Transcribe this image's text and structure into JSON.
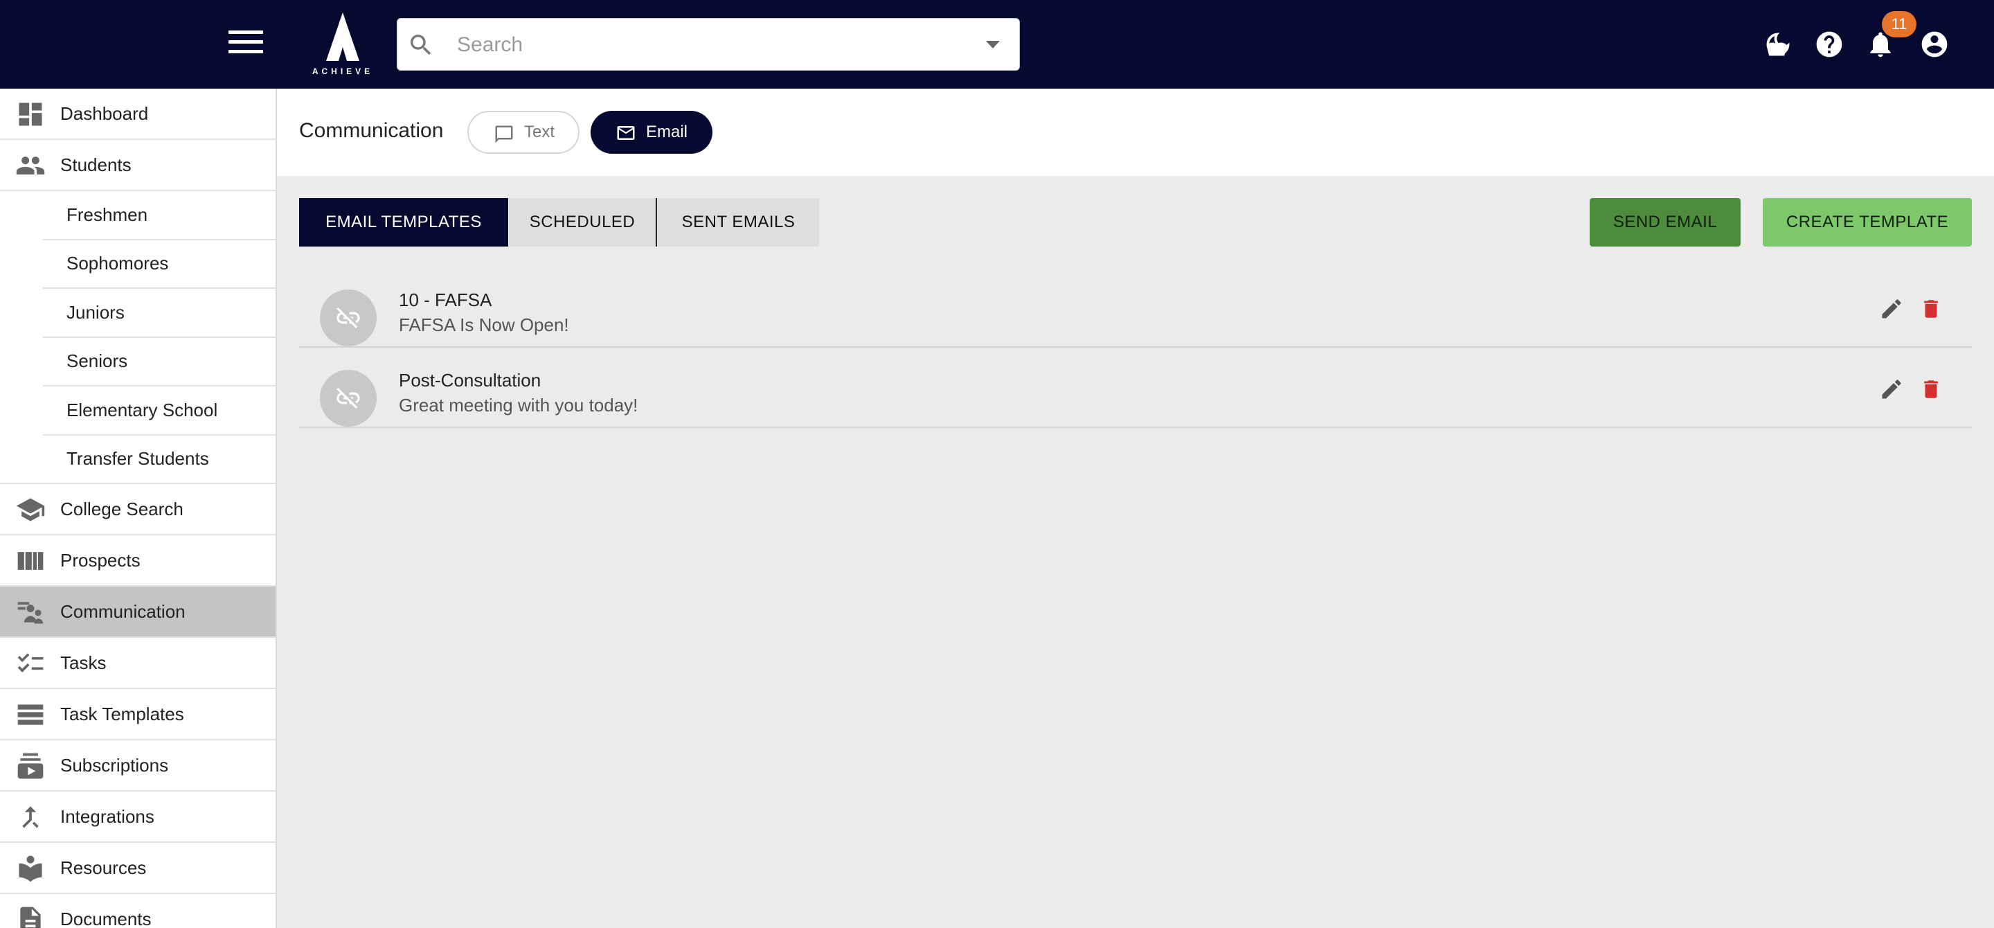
{
  "header": {
    "logo_text": "ACHIEVE",
    "search_placeholder": "Search",
    "notification_count": "11",
    "icons": [
      "menu-icon",
      "search-icon",
      "dropdown-caret-icon",
      "dark-mode-icon",
      "help-icon",
      "bell-icon",
      "account-icon"
    ]
  },
  "sidebar": {
    "items": [
      {
        "label": "Dashboard",
        "icon": "dashboard-icon"
      },
      {
        "label": "Students",
        "icon": "people-icon"
      },
      {
        "label": "College Search",
        "icon": "school-icon"
      },
      {
        "label": "Prospects",
        "icon": "columns-icon"
      },
      {
        "label": "Communication",
        "icon": "communication-icon",
        "active": true
      },
      {
        "label": "Tasks",
        "icon": "checklist-icon"
      },
      {
        "label": "Task Templates",
        "icon": "list-icon"
      },
      {
        "label": "Subscriptions",
        "icon": "subscriptions-icon"
      },
      {
        "label": "Integrations",
        "icon": "merge-icon"
      },
      {
        "label": "Resources",
        "icon": "book-icon"
      },
      {
        "label": "Documents",
        "icon": "document-icon"
      }
    ],
    "student_subitems": [
      "Freshmen",
      "Sophomores",
      "Juniors",
      "Seniors",
      "Elementary School",
      "Transfer Students"
    ]
  },
  "page": {
    "title": "Communication",
    "mode_toggle": {
      "text_label": "Text",
      "email_label": "Email",
      "selected": "Email"
    }
  },
  "tabs": {
    "email_templates": "EMAIL TEMPLATES",
    "scheduled": "SCHEDULED",
    "sent_emails": "SENT EMAILS",
    "active": "EMAIL TEMPLATES"
  },
  "actions": {
    "send_email": "SEND EMAIL",
    "create_template": "CREATE TEMPLATE"
  },
  "templates": [
    {
      "name": "10 - FAFSA",
      "subject": "FAFSA Is Now Open!"
    },
    {
      "name": "Post-Consultation",
      "subject": "Great meeting with you today!"
    }
  ],
  "colors": {
    "navbar": "#070a30",
    "badge": "#e8742c",
    "send_button": "#4d8b3d",
    "create_button": "#7cc86a",
    "delete_icon": "#d32f2f"
  }
}
